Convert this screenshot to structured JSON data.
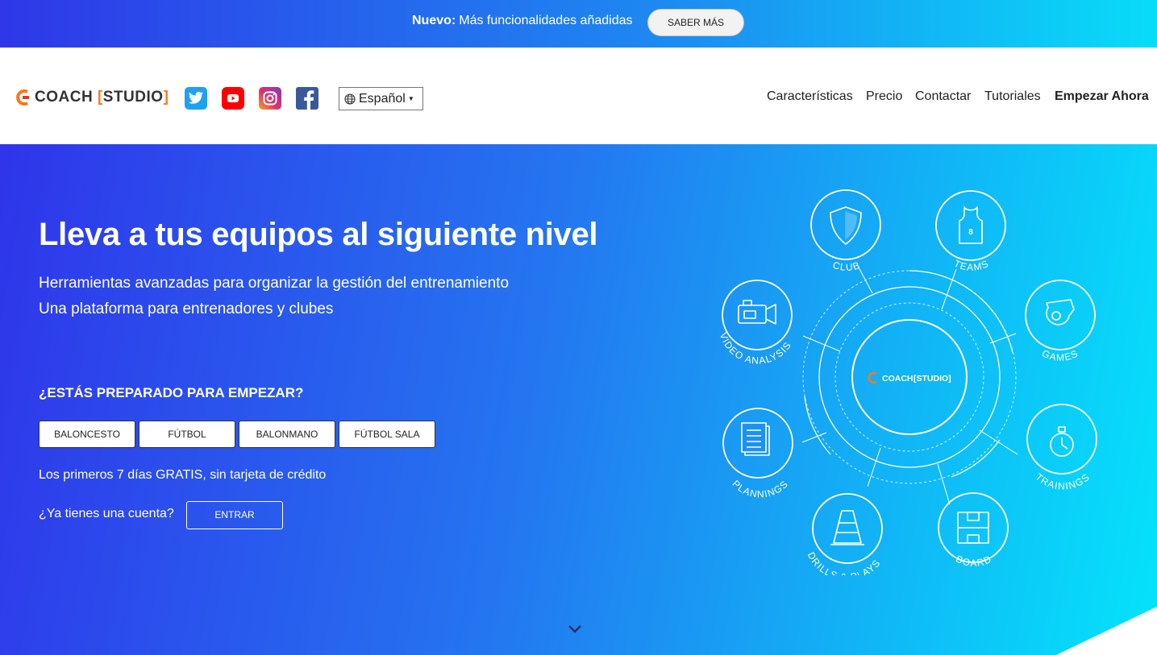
{
  "announcement": {
    "bold_label": "Nuevo:",
    "text": "Más funcionalidades añadidas",
    "button_label": "SABER MÁS"
  },
  "header": {
    "logo_main": "COACH",
    "logo_bracket_open": "[",
    "logo_sub": "STUDIO",
    "logo_bracket_close": "]",
    "social_icons": [
      "twitter-icon",
      "youtube-icon",
      "instagram-icon",
      "facebook-icon"
    ],
    "language": "Español",
    "nav": [
      {
        "label": "Características"
      },
      {
        "label": "Precio"
      },
      {
        "label": "Contactar"
      },
      {
        "label": "Tutoriales"
      },
      {
        "label": "Empezar Ahora"
      }
    ]
  },
  "hero": {
    "title": "Lleva a tus equipos al siguiente nivel",
    "subtitle_line1": "Herramientas avanzadas para organizar la gestión del entrenamiento",
    "subtitle_line2": "Una plataforma para entrenadores y clubes",
    "ready_heading": "¿ESTÁS PREPARADO PARA EMPEZAR?",
    "sports": [
      "BALONCESTO",
      "FÚTBOL",
      "BALONMANO",
      "FÚTBOL SALA"
    ],
    "trial_text": "Los primeros 7 días GRATIS, sin tarjeta de crédito",
    "account_prompt": "¿Ya tienes una cuenta?",
    "login_button": "ENTRAR"
  },
  "diagram": {
    "center_logo_main": "COACH",
    "center_logo_sub": "[STUDIO]",
    "features": [
      {
        "label": "CLUB",
        "icon": "shield-icon"
      },
      {
        "label": "TEAMS",
        "icon": "jersey-icon"
      },
      {
        "label": "GAMES",
        "icon": "whistle-icon"
      },
      {
        "label": "TRAININGS",
        "icon": "stopwatch-icon"
      },
      {
        "label": "BOARD",
        "icon": "court-board-icon"
      },
      {
        "label": "DRILLS & PLAYS",
        "icon": "cone-icon"
      },
      {
        "label": "PLANNINGS",
        "icon": "calendar-icon"
      },
      {
        "label": "VIDEO ANALYSIS",
        "icon": "video-camera-icon"
      }
    ]
  },
  "colors": {
    "brand_orange": "#f47a1f",
    "hero_start": "#2f35ea",
    "hero_end": "#05e3fb",
    "twitter": "#1da1f2",
    "youtube": "#ff0000",
    "facebook": "#3b5998"
  }
}
